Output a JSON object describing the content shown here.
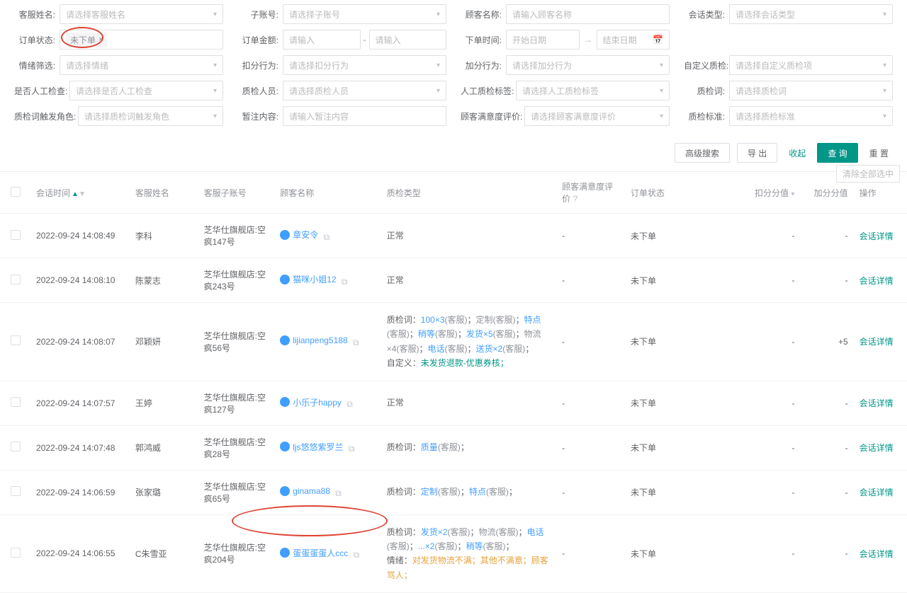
{
  "filters": {
    "row1": {
      "agent_name": {
        "label": "客服姓名:",
        "ph": "请选择客服姓名"
      },
      "sub_account": {
        "label": "子账号:",
        "ph": "请选择子账号"
      },
      "cust_name": {
        "label": "顾客名称:",
        "ph": "请输入顾客名称"
      },
      "session_type": {
        "label": "会话类型:",
        "ph": "请选择会话类型"
      }
    },
    "row2": {
      "order_status": {
        "label": "订单状态:",
        "tag": "未下单"
      },
      "order_amount": {
        "label": "订单金额:",
        "ph_from": "请输入",
        "ph_to": "请输入"
      },
      "order_time": {
        "label": "下单时间:",
        "ph_start": "开始日期",
        "ph_end": "结束日期"
      },
      "blank": {
        "label": ""
      }
    },
    "row3": {
      "mood_filter": {
        "label": "情绪筛选:",
        "ph": "请选择情绪"
      },
      "deduct": {
        "label": "扣分行为:",
        "ph": "请选择扣分行为"
      },
      "add": {
        "label": "加分行为:",
        "ph": "请选择加分行为"
      },
      "custom_qc": {
        "label": "自定义质检:",
        "ph": "请选择自定义质检项"
      }
    },
    "row4": {
      "is_manual": {
        "label": "是否人工检查:",
        "ph": "请选择是否人工检查"
      },
      "qc_staff": {
        "label": "质检人员:",
        "ph": "请选择质检人员"
      },
      "manual_tag": {
        "label": "人工质检标签:",
        "ph": "请选择人工质检标签"
      },
      "qc_keyword": {
        "label": "质检词:",
        "ph": "请选择质检词"
      }
    },
    "row5": {
      "trigger_role": {
        "label": "质检词触发角色:",
        "ph": "请选择质检词触发角色"
      },
      "remark": {
        "label": "暂注内容:",
        "ph": "请输入暂注内容"
      },
      "satisfaction": {
        "label": "顾客满意度评价:",
        "ph": "请选择顾客满意度评价"
      },
      "qc_standard": {
        "label": "质检标准:",
        "ph": "请选择质检标准"
      }
    }
  },
  "actions": {
    "adv": "高级搜索",
    "export": "导 出",
    "collapse": "收起",
    "query": "查 询",
    "reset": "重 置",
    "clear_sel": "清除全部选中"
  },
  "columns": {
    "time": "会话时间",
    "agent": "客服姓名",
    "sub": "客服子账号",
    "cust": "顾客名称",
    "qc": "质检类型",
    "sat": "顾客满意度评价",
    "order": "订单状态",
    "neg": "扣分分值",
    "pos": "加分分值",
    "op": "操作"
  },
  "rows": [
    {
      "time": "2022-09-24 14:08:49",
      "agent": "李科",
      "sub": "芝华仕旗舰店:空疯147号",
      "cust": "章安令",
      "qc_html": "正常",
      "sat": "-",
      "order": "未下单",
      "neg": "-",
      "pos": "-",
      "op": "会话详情"
    },
    {
      "time": "2022-09-24 14:08:10",
      "agent": "陈蒙志",
      "sub": "芝华仕旗舰店:空疯243号",
      "cust": "猫咪小姐12",
      "qc_html": "正常",
      "sat": "-",
      "order": "未下单",
      "neg": "-",
      "pos": "-",
      "op": "会话详情"
    },
    {
      "time": "2022-09-24 14:08:07",
      "agent": "邓颖妍",
      "sub": "芝华仕旗舰店:空疯56号",
      "cust": "lijianpeng5188",
      "qc_html": "<span>质检词：</span><span class='kw-blue'>100×3</span><span class='kw-gray'>(客服)</span>；<span class='kw-gray'>定制(客服)</span>；<span class='kw-blue'>特点</span><span class='kw-gray'>(客服)</span>；<span class='kw-blue'>稍等</span><span class='kw-gray'>(客服)</span>；<span class='kw-blue'>发货×5</span><span class='kw-gray'>(客服)</span>；<span class='kw-gray'>物流×4(客服)</span>；<span class='kw-blue'>电话</span><span class='kw-gray'>(客服)</span>；<span class='kw-blue'>送货×2</span><span class='kw-gray'>(客服)</span>；<br><span>自定义：</span><span class='kw-teal'>未发货退款-优惠券核；</span>",
      "sat": "-",
      "order": "未下单",
      "neg": "-",
      "pos": "+5",
      "op": "会话详情"
    },
    {
      "time": "2022-09-24 14:07:57",
      "agent": "王婷",
      "sub": "芝华仕旗舰店:空疯127号",
      "cust": "小乐子happy",
      "qc_html": "正常",
      "sat": "-",
      "order": "未下单",
      "neg": "-",
      "pos": "-",
      "op": "会话详情"
    },
    {
      "time": "2022-09-24 14:07:48",
      "agent": "郭鸿威",
      "sub": "芝华仕旗舰店:空疯28号",
      "cust": "ljs悠悠紫罗兰",
      "qc_html": "<span>质检词：</span><span class='kw-blue'>质量</span><span class='kw-gray'>(客服)</span>；",
      "sat": "-",
      "order": "未下单",
      "neg": "-",
      "pos": "-",
      "op": "会话详情"
    },
    {
      "time": "2022-09-24 14:06:59",
      "agent": "张家璐",
      "sub": "芝华仕旗舰店:空疯65号",
      "cust": "ginama88",
      "qc_html": "<span>质检词：</span><span class='kw-blue'>定制</span><span class='kw-gray'>(客服)</span>；<span class='kw-blue'>特点</span><span class='kw-gray'>(客服)</span>；",
      "sat": "-",
      "order": "未下单",
      "neg": "-",
      "pos": "-",
      "op": "会话详情"
    },
    {
      "time": "2022-09-24 14:06:55",
      "agent": "C朱雪亚",
      "sub": "芝华仕旗舰店:空疯204号",
      "cust": "蛋蛋蛋蛋人ccc",
      "qc_html": "<span>质检词：</span><span class='kw-blue'>发货×2</span><span class='kw-gray'>(客服)</span>；<span class='kw-gray'>物流(客服)</span>；<span class='kw-blue'>电话</span><span class='kw-gray'>(客服)</span>；<span class='kw-blue'>...×2</span><span class='kw-gray'>(客服)</span>；<span class='kw-blue'>稍等</span><span class='kw-gray'>(客服)</span>；<br><span>情绪：</span><span class='kw-orange'>对发货物流不满；其他不满意；顾客骂人；</span>",
      "sat": "-",
      "order": "未下单",
      "neg": "-",
      "pos": "-",
      "op": "会话详情"
    }
  ]
}
